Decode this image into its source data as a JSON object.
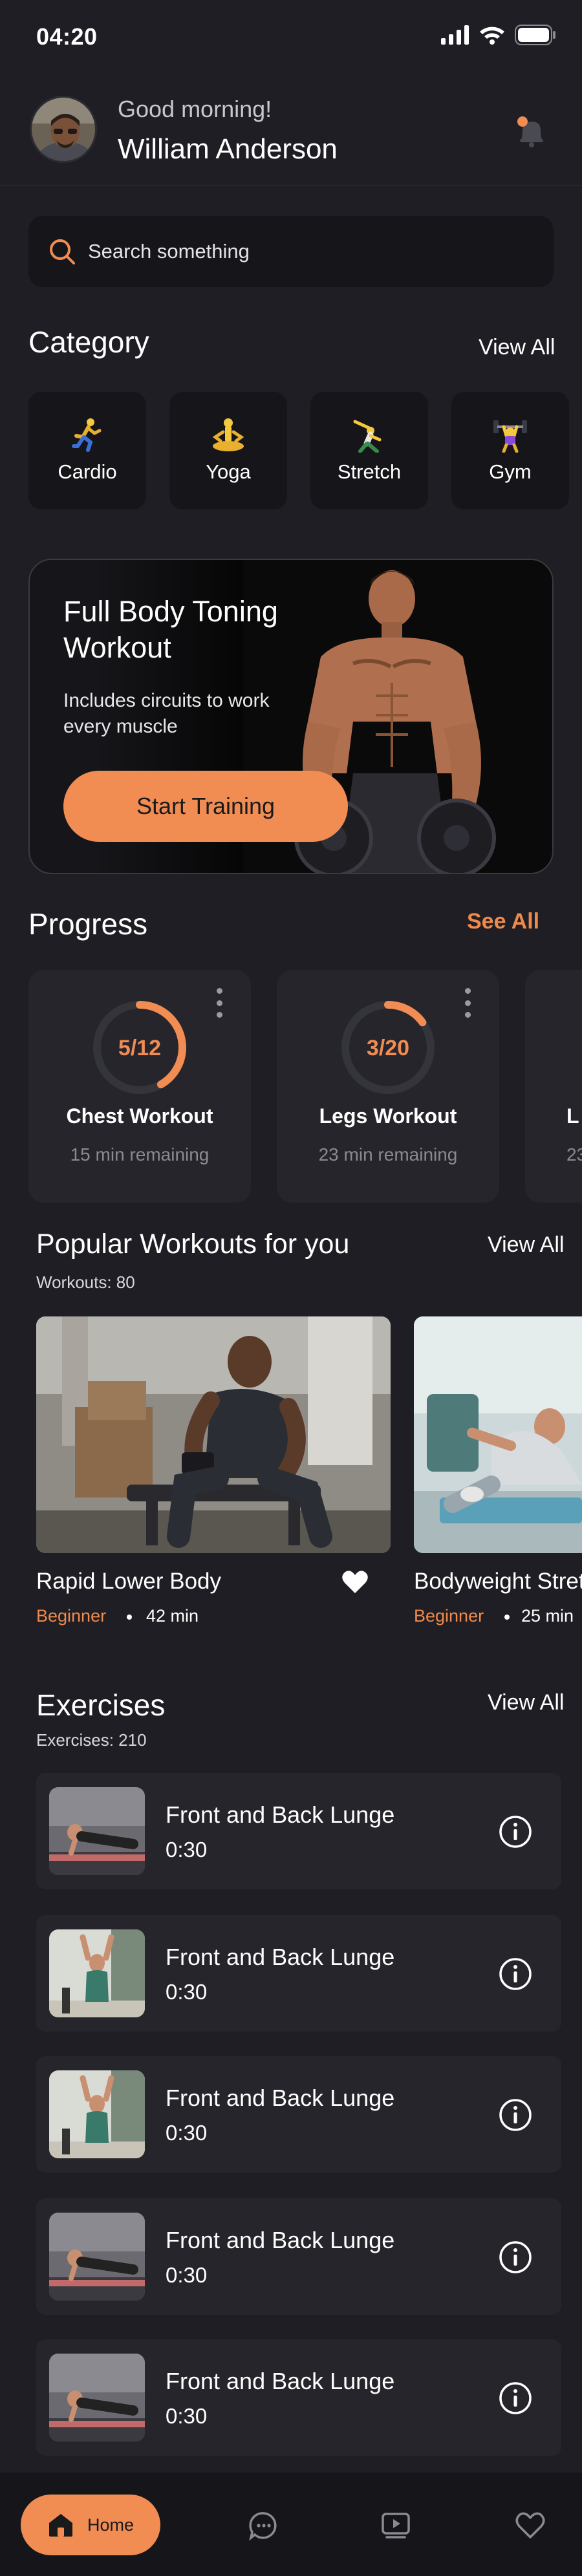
{
  "status_bar": {
    "time": "04:20"
  },
  "header": {
    "greeting": "Good morning!",
    "user_name": "William Anderson"
  },
  "search": {
    "placeholder": "Search something"
  },
  "category": {
    "title": "Category",
    "view_all": "View All",
    "items": [
      {
        "label": "Cardio",
        "icon": "running-icon"
      },
      {
        "label": "Yoga",
        "icon": "yoga-icon"
      },
      {
        "label": "Stretch",
        "icon": "stretch-icon"
      },
      {
        "label": "Gym",
        "icon": "weightlifting-icon"
      }
    ]
  },
  "hero": {
    "title": "Full Body Toning Workout",
    "subtitle": "Includes circuits to work every muscle",
    "button": "Start Training"
  },
  "progress": {
    "title": "Progress",
    "see_all": "See All",
    "items": [
      {
        "count": "5/12",
        "fraction": 0.4167,
        "label": "Chest Workout",
        "remaining": "15 min remaining"
      },
      {
        "count": "3/20",
        "fraction": 0.15,
        "label": "Legs Workout",
        "remaining": "23 min remaining"
      },
      {
        "count": "",
        "fraction": 0,
        "label": "L",
        "remaining": "23"
      }
    ]
  },
  "popular": {
    "title": "Popular Workouts for you",
    "view_all": "View All",
    "count_label": "Workouts: 80",
    "items": [
      {
        "name": "Rapid Lower Body",
        "level": "Beginner",
        "duration": "42 min"
      },
      {
        "name": "Bodyweight Stretch",
        "level": "Beginner",
        "duration": "25 min"
      }
    ]
  },
  "exercises": {
    "title": "Exercises",
    "view_all": "View All",
    "count_label": "Exercises: 210",
    "items": [
      {
        "name": "Front and Back Lunge",
        "duration": "0:30",
        "pose": "plank"
      },
      {
        "name": "Front and Back Lunge",
        "duration": "0:30",
        "pose": "arms-up"
      },
      {
        "name": "Front and Back Lunge",
        "duration": "0:30",
        "pose": "arms-up"
      },
      {
        "name": "Front and Back Lunge",
        "duration": "0:30",
        "pose": "plank"
      },
      {
        "name": "Front and Back Lunge",
        "duration": "0:30",
        "pose": "plank"
      }
    ]
  },
  "bottom_nav": {
    "home": "Home"
  },
  "colors": {
    "accent": "#f18c53",
    "background": "#1e1e24",
    "card": "#25252b",
    "dark_card": "#16161a"
  }
}
